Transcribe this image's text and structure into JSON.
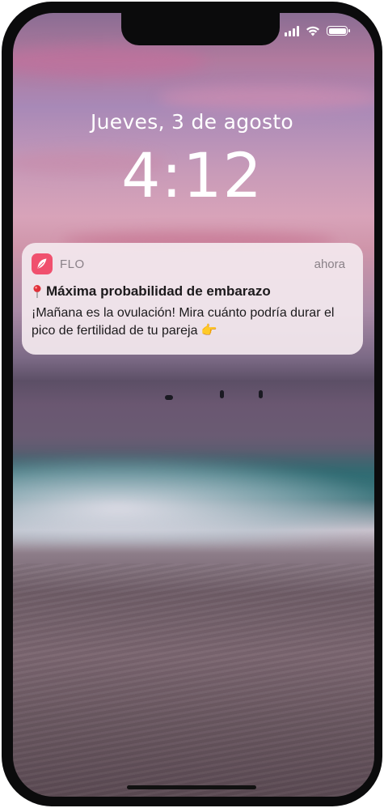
{
  "lock_screen": {
    "date": "Jueves, 3 de agosto",
    "time": "4:12"
  },
  "status_bar": {
    "signal_icon": "cellular-signal-icon",
    "wifi_icon": "wifi-icon",
    "battery_icon": "battery-icon"
  },
  "notification": {
    "app_name": "FLO",
    "time": "ahora",
    "title_icon": "round-pushpin-icon",
    "title": "Máxima probabilidad de embarazo",
    "body": "¡Mañana es la ovulación! Mira cuánto podría durar el pico de fertilidad de tu pareja 👉",
    "app_icon_color": "#f0506e"
  }
}
